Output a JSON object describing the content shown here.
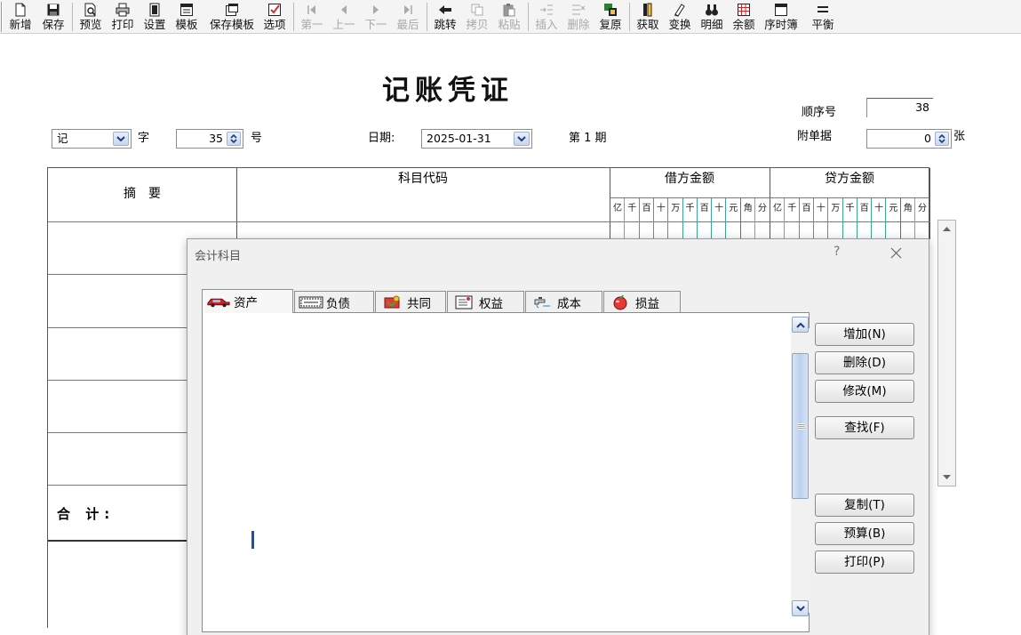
{
  "toolbar": {
    "buttons": [
      {
        "label": "新增",
        "icon": "new-document-icon",
        "enabled": true
      },
      {
        "label": "保存",
        "icon": "floppy-save-icon",
        "enabled": true
      },
      {
        "label": "预览",
        "icon": "print-preview-icon",
        "enabled": true
      },
      {
        "label": "打印",
        "icon": "printer-icon",
        "enabled": true
      },
      {
        "label": "设置",
        "icon": "page-setup-icon",
        "enabled": true
      },
      {
        "label": "模板",
        "icon": "template-icon",
        "enabled": true
      },
      {
        "label": "保存模板",
        "icon": "save-template-icon",
        "enabled": true
      },
      {
        "label": "选项",
        "icon": "options-check-icon",
        "enabled": true
      },
      {
        "label": "第一",
        "icon": "first-record-icon",
        "enabled": false
      },
      {
        "label": "上一",
        "icon": "previous-record-icon",
        "enabled": false
      },
      {
        "label": "下一",
        "icon": "next-record-icon",
        "enabled": false
      },
      {
        "label": "最后",
        "icon": "last-record-icon",
        "enabled": false
      },
      {
        "label": "跳转",
        "icon": "jump-arrow-icon",
        "enabled": true
      },
      {
        "label": "拷贝",
        "icon": "copy-icon",
        "enabled": false
      },
      {
        "label": "粘贴",
        "icon": "paste-icon",
        "enabled": false
      },
      {
        "label": "插入",
        "icon": "insert-row-icon",
        "enabled": false
      },
      {
        "label": "删除",
        "icon": "delete-row-icon",
        "enabled": false
      },
      {
        "label": "复原",
        "icon": "restore-icon",
        "enabled": true
      },
      {
        "label": "获取",
        "icon": "fetch-book-icon",
        "enabled": true
      },
      {
        "label": "变换",
        "icon": "transform-icon",
        "enabled": true
      },
      {
        "label": "明细",
        "icon": "binoculars-icon",
        "enabled": true
      },
      {
        "label": "余额",
        "icon": "balance-grid-icon",
        "enabled": true
      },
      {
        "label": "序时簿",
        "icon": "journal-window-icon",
        "enabled": true
      },
      {
        "label": "平衡",
        "icon": "balance-equal-icon",
        "enabled": true
      }
    ]
  },
  "voucher": {
    "title": "记账凭证",
    "word_value": "记",
    "word_label": "字",
    "number_value": "35",
    "number_label": "号",
    "date_label": "日期:",
    "date_value": "2025-01-31",
    "period_label": "第 1 期",
    "seq_label": "顺序号",
    "seq_value": "38",
    "attach_label": "附单据",
    "attach_value": "0",
    "attach_unit": "张"
  },
  "grid": {
    "col_summary": "摘　要",
    "col_account": "科目代码",
    "col_debit": "借方金额",
    "col_credit": "贷方金额",
    "digits": [
      "亿",
      "千",
      "百",
      "十",
      "万",
      "千",
      "百",
      "十",
      "元",
      "角",
      "分"
    ],
    "total_label": "合 计:"
  },
  "dialog": {
    "title": "会计科目",
    "help": "?",
    "tabs": [
      {
        "label": "资产",
        "icon": "car-icon"
      },
      {
        "label": "负债",
        "icon": "banknote-icon"
      },
      {
        "label": "共同",
        "icon": "tools-icon"
      },
      {
        "label": "权益",
        "icon": "certificate-icon"
      },
      {
        "label": "成本",
        "icon": "faucet-icon"
      },
      {
        "label": "损益",
        "icon": "apple-icon"
      }
    ],
    "buttons": {
      "add": "增加(N)",
      "delete": "删除(D)",
      "modify": "修改(M)",
      "find": "查找(F)",
      "copy": "复制(T)",
      "budget": "预算(B)",
      "print": "打印(P)"
    }
  },
  "colors": {
    "red_rule": "#e53935",
    "green_rule": "#3aa88a",
    "accent": "#0c55b3"
  }
}
